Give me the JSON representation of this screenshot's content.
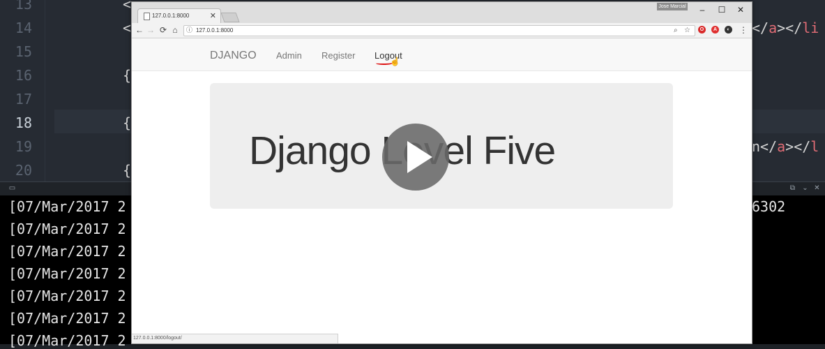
{
  "editor": {
    "line_numbers": [
      "13",
      "14",
      "15",
      "16",
      "17",
      "18",
      "19",
      "20"
    ],
    "active_line": "18",
    "fragments": {
      "l13": "<",
      "l14": "<",
      "l16": "{",
      "l18": "{",
      "l20": "{",
      "l14_right_text": "</",
      "l14_right_tag": "a",
      "l14_right_text2": "></",
      "l14_right_tag2": "li",
      "l19_right_text": "n</",
      "l19_right_tag": "a",
      "l19_right_text2": "></",
      "l19_right_tag2": "l"
    }
  },
  "terminal": {
    "lines": [
      "[07/Mar/2017 2",
      "[07/Mar/2017 2",
      "[07/Mar/2017 2",
      "[07/Mar/2017 2",
      "[07/Mar/2017 2",
      "[07/Mar/2017 2",
      "[07/Mar/2017 2"
    ],
    "first_line_right": "6302"
  },
  "browser": {
    "tab_title": "127.0.0.1:8000",
    "user_badge": "Jose Marcial",
    "url": "127.0.0.1:8000",
    "status_url": "127.0.0.1:8000/logout/",
    "icons": {
      "back": "←",
      "forward": "→",
      "reload": "⟳",
      "home": "⌂",
      "info": "ⓘ",
      "zoom": "🔍",
      "star": "☆",
      "menu": "⋮",
      "minimize": "–",
      "maximize": "☐",
      "close": "✕"
    }
  },
  "site": {
    "brand": "DJANGO",
    "nav": [
      "Admin",
      "Register",
      "Logout"
    ],
    "jumbotron_title": "Django Level Five"
  }
}
